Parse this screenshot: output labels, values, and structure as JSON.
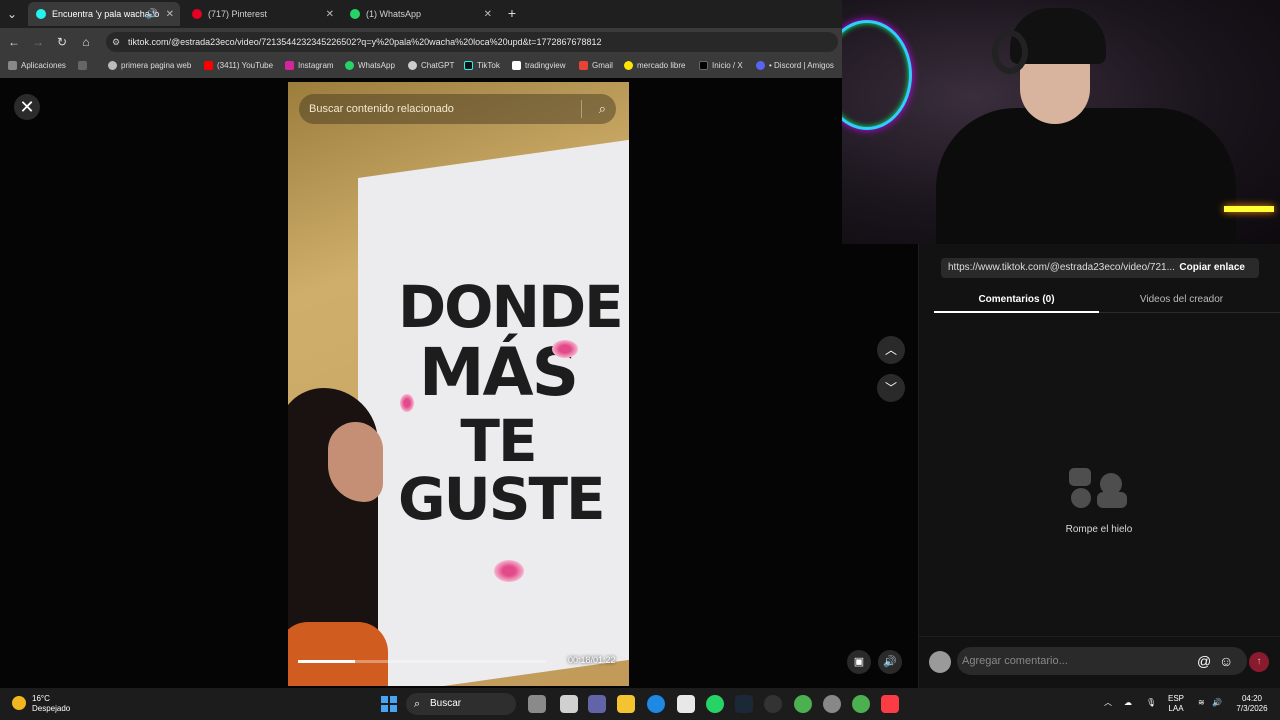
{
  "tabs": [
    {
      "label": "Encuentra 'y pala wacha lo",
      "active": true,
      "color": "#25f4ee"
    },
    {
      "label": "(717) Pinterest",
      "active": false,
      "color": "#e60023"
    },
    {
      "label": "(1) WhatsApp",
      "active": false,
      "color": "#25d366"
    }
  ],
  "address": {
    "url": "tiktok.com/@estrada23eco/video/7213544232345226502?q=y%20pala%20wacha%20loca%20upd&t=1772867678812"
  },
  "bookmarks": [
    {
      "label": "Aplicaciones",
      "color": "#888888"
    },
    {
      "label": "primera pagina web",
      "color": "#bbbbbb"
    },
    {
      "label": "(3411) YouTube",
      "color": "#ff0000"
    },
    {
      "label": "Instagram",
      "color": "#d6249f"
    },
    {
      "label": "WhatsApp",
      "color": "#25d366"
    },
    {
      "label": "ChatGPT",
      "color": "#cccccc"
    },
    {
      "label": "TikTok",
      "color": "#111111"
    },
    {
      "label": "tradingview",
      "color": "#ffffff"
    },
    {
      "label": "Gmail",
      "color": "#ea4335"
    },
    {
      "label": "mercado libre",
      "color": "#ffe600"
    },
    {
      "label": "Inicio / X",
      "color": "#000000"
    },
    {
      "label": "• Discord | Amigos",
      "color": "#5865f2"
    }
  ],
  "viewer": {
    "search_placeholder": "Buscar contenido relacionado",
    "time": "00:18/01:22",
    "progress": 0.23,
    "poster_lines": [
      "DONDE",
      "MÁS",
      "TE GUSTE"
    ]
  },
  "panel": {
    "link": "https://www.tiktok.com/@estrada23eco/video/721...",
    "copy_label": "Copiar enlace",
    "tab_comments": "Comentarios (0)",
    "tab_videos": "Videos del creador",
    "empty_text": "Rompe el hielo",
    "comment_placeholder": "Agregar comentario..."
  },
  "taskbar": {
    "temp": "16°C",
    "weather": "Despejado",
    "search": "Buscar",
    "lang_top": "ESP",
    "lang_bottom": "LAA",
    "clock_time": "04:20",
    "clock_date": "7/3/2026"
  }
}
